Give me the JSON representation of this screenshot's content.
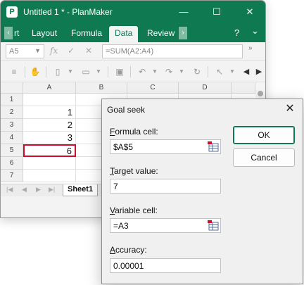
{
  "window": {
    "title": "Untitled 1 * - PlanMaker",
    "app_icon_letter": "P",
    "minimize": "—",
    "maximize": "☐",
    "close": "✕"
  },
  "ribbon": {
    "scroll_left": "‹",
    "scroll_right": "›",
    "tabs": [
      "rt",
      "Layout",
      "Formula",
      "Data",
      "Review"
    ],
    "active_tab": "Data",
    "help": "?",
    "collapse": "⌄"
  },
  "formula_bar": {
    "cell_ref": "A5",
    "formula": "=SUM(A2:A4)",
    "fx": "fx",
    "more": "»"
  },
  "sheet": {
    "columns": [
      "A",
      "B",
      "C",
      "D"
    ],
    "rows": [
      "1",
      "2",
      "3",
      "4",
      "5",
      "6",
      "7"
    ],
    "cells_a": [
      "",
      "1",
      "2",
      "3",
      "6",
      "",
      ""
    ],
    "selected_row": "5",
    "tab_name": "Sheet1"
  },
  "dialog": {
    "title": "Goal seek",
    "close": "✕",
    "formula_cell": {
      "label_u": "F",
      "label_rest": "ormula cell:",
      "value": "$A$5"
    },
    "target_value": {
      "label_u": "T",
      "label_rest": "arget value:",
      "value": "7"
    },
    "variable_cell": {
      "label_u": "V",
      "label_rest": "ariable cell:",
      "value": "=A3"
    },
    "accuracy": {
      "label_u": "A",
      "label_rest": "ccuracy:",
      "value": "0.00001"
    },
    "ok_label": "OK",
    "cancel_label": "Cancel"
  },
  "colors": {
    "accent": "#0f7a52",
    "selection": "#c8102e"
  }
}
